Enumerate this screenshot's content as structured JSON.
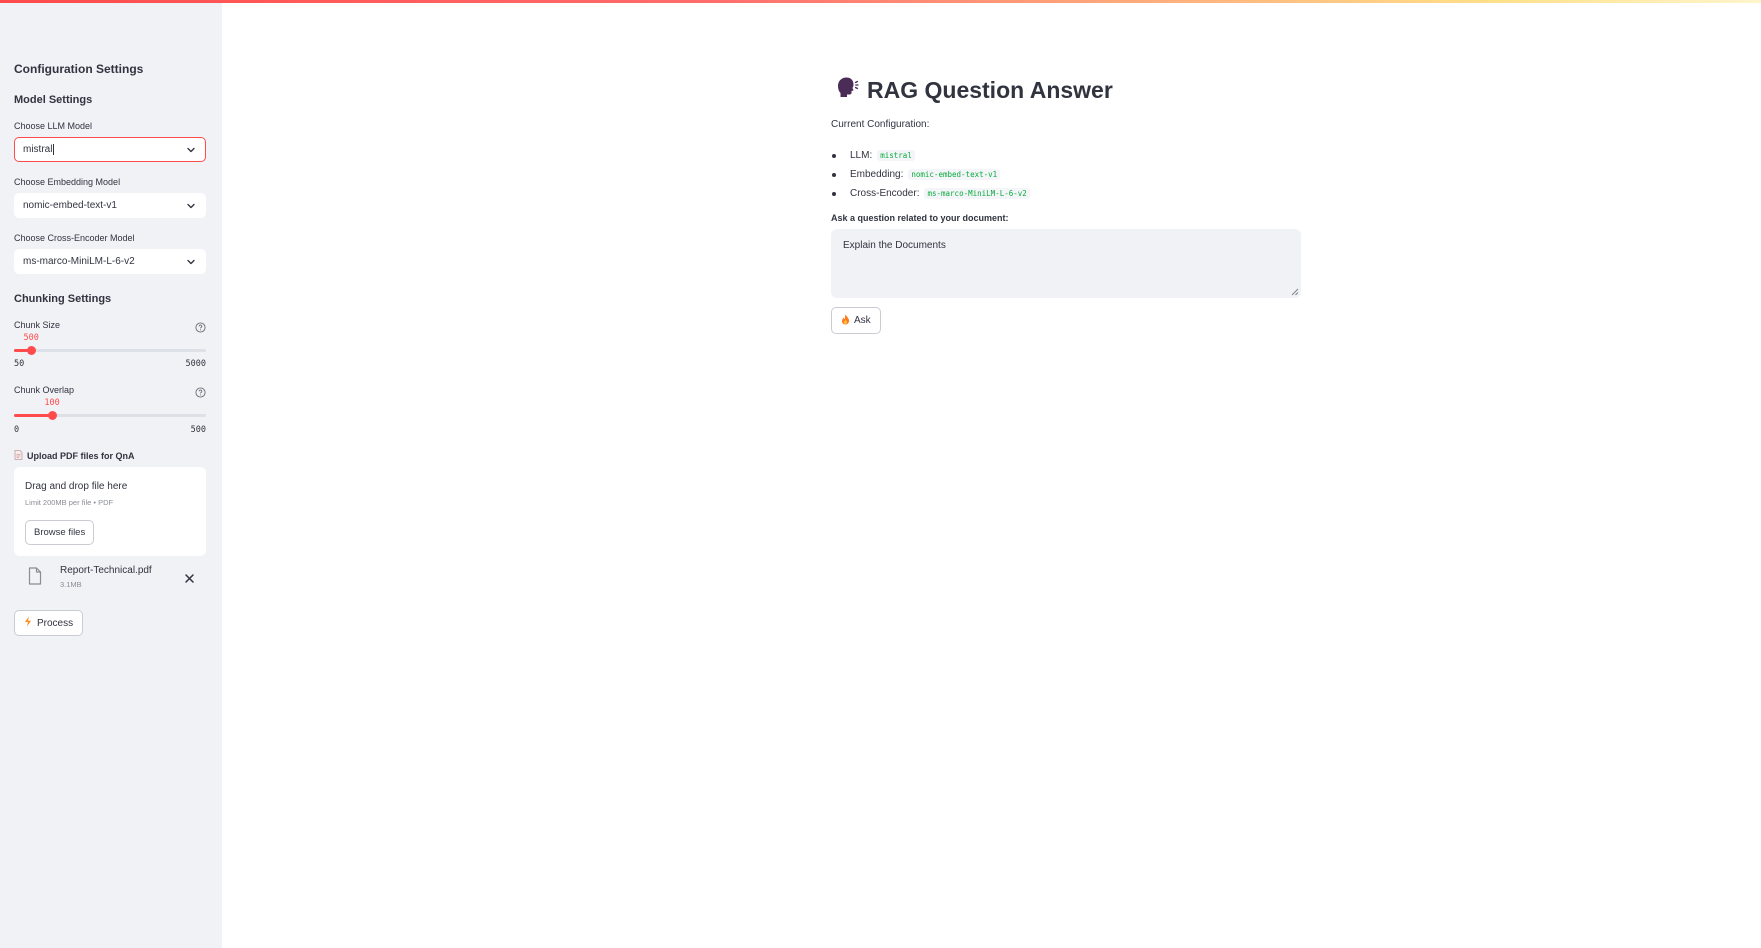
{
  "colors": {
    "accent": "#ff4b4b",
    "sidebar_bg": "#f0f2f6",
    "code_green": "#09ab3b",
    "text": "#31333f"
  },
  "sidebar": {
    "title": "Configuration Settings",
    "model_settings": {
      "heading": "Model Settings",
      "llm": {
        "label": "Choose LLM Model",
        "value": "mistral"
      },
      "embedding": {
        "label": "Choose Embedding Model",
        "value": "nomic-embed-text-v1"
      },
      "cross_encoder": {
        "label": "Choose Cross-Encoder Model",
        "value": "ms-marco-MiniLM-L-6-v2"
      }
    },
    "chunking_settings": {
      "heading": "Chunking Settings",
      "chunk_size": {
        "label": "Chunk Size",
        "value": 500,
        "value_text": "500",
        "min": 50,
        "min_text": "50",
        "max": 5000,
        "max_text": "5000"
      },
      "chunk_overlap": {
        "label": "Chunk Overlap",
        "value": 100,
        "value_text": "100",
        "min": 0,
        "min_text": "0",
        "max": 500,
        "max_text": "500"
      }
    },
    "upload": {
      "label": "Upload PDF files for QnA",
      "drop_title": "Drag and drop file here",
      "drop_limit": "Limit 200MB per file • PDF",
      "browse_label": "Browse files",
      "file": {
        "name": "Report-Technical.pdf",
        "size": "3.1MB"
      }
    },
    "process_label": "Process"
  },
  "main": {
    "title": "RAG Question Answer",
    "config_label": "Current Configuration:",
    "config_items": [
      {
        "label": "LLM:",
        "value": "mistral"
      },
      {
        "label": "Embedding:",
        "value": "nomic-embed-text-v1"
      },
      {
        "label": "Cross-Encoder:",
        "value": "ms-marco-MiniLM-L-6-v2"
      }
    ],
    "question_label": "Ask a question related to your document:",
    "question_value": "Explain the Documents",
    "ask_label": "Ask"
  },
  "icons": {
    "title_icon": "speaking-head-icon",
    "upload_icon": "page-icon",
    "file_icon": "file-icon",
    "process_icon": "lightning-icon",
    "ask_icon": "fire-icon"
  }
}
